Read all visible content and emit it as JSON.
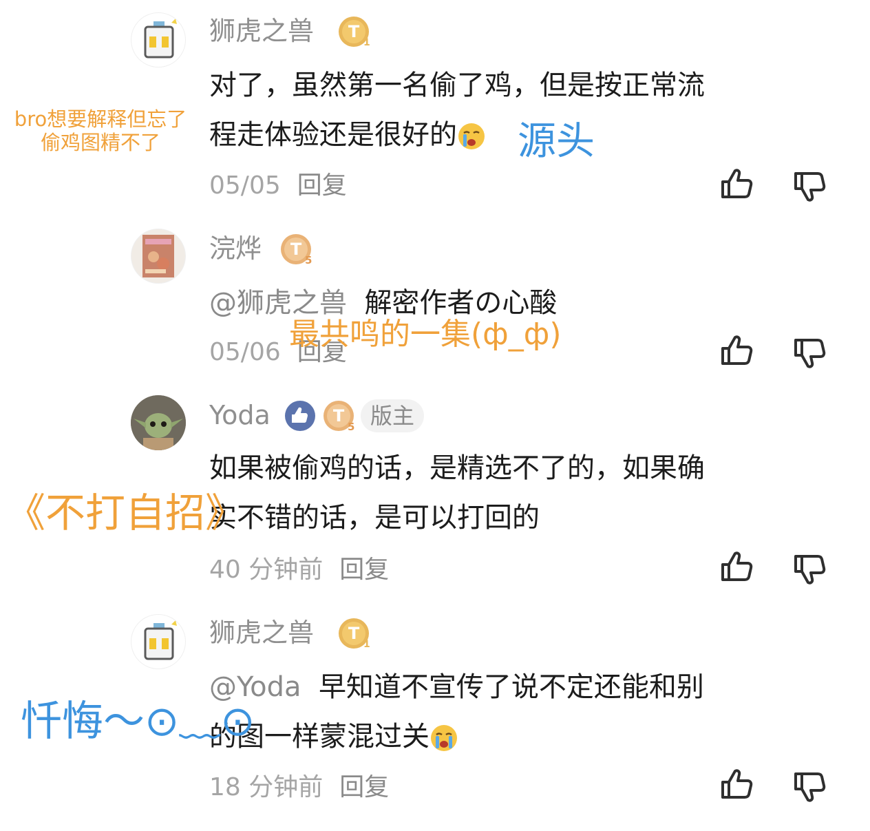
{
  "comments": [
    {
      "user": "狮虎之兽",
      "badge_level": "1",
      "text_line1": "对了，虽然第一名偷了鸡，但是按正常流",
      "text_line2": "程走体验还是很好的",
      "time": "05/05",
      "reply": "回复"
    },
    {
      "user": "浣烨",
      "badge_level": "5",
      "mention": "@狮虎之兽",
      "text": "解密作者の心酸",
      "time": "05/06",
      "reply": "回复"
    },
    {
      "user": "Yoda",
      "badge_level": "5",
      "role": "版主",
      "text_line1": "如果被偷鸡的话，是精选不了的，如果确",
      "text_line2": "实不错的话，是可以打回的",
      "time": "40 分钟前",
      "reply": "回复"
    },
    {
      "user": "狮虎之兽",
      "badge_level": "1",
      "mention": "@Yoda",
      "text_line1": "早知道不宣传了说不定还能和别",
      "text_line2": "的图一样蒙混过关",
      "time": "18 分钟前",
      "reply": "回复"
    }
  ],
  "annotations": {
    "a1_line1": "bro想要解释但忘了",
    "a1_line2": "偷鸡图精不了",
    "a2": "源头",
    "a3": "最共鸣的一集(ф_ф)",
    "a4": "《不打自招》",
    "a5": "忏悔～⊙﹏⊙"
  },
  "colors": {
    "annotation_orange": "#f0a13a",
    "annotation_blue": "#3d93de",
    "badge_gold": "#e8b75a",
    "username_gray": "#8f8f8f"
  }
}
